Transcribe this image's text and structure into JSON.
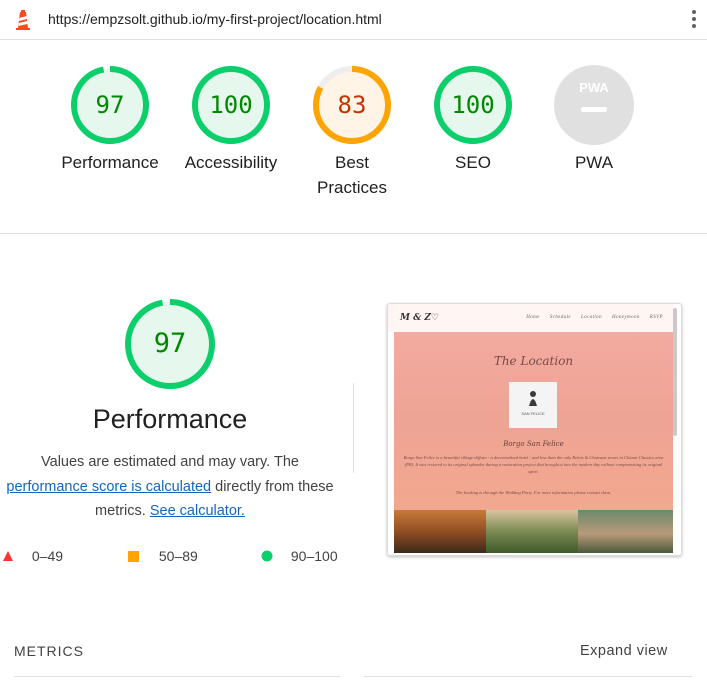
{
  "header": {
    "url": "https://empzsolt.github.io/my-first-project/location.html",
    "logo_icon": "lighthouse-icon",
    "menu_icon": "kebab-menu-icon"
  },
  "gauges": [
    {
      "label": "Performance",
      "score": "97",
      "value": 0.97,
      "color": "#0cce6b",
      "fill": "#e6f8ee",
      "text_color": "#008800"
    },
    {
      "label": "Accessibility",
      "score": "100",
      "value": 1.0,
      "color": "#0cce6b",
      "fill": "#e6f8ee",
      "text_color": "#008800"
    },
    {
      "label_line1": "Best",
      "label_line2": "Practices",
      "score": "83",
      "value": 0.83,
      "color": "#ffa400",
      "fill": "#fff4e5",
      "text_color": "#c33300"
    },
    {
      "label": "SEO",
      "score": "100",
      "value": 1.0,
      "color": "#0cce6b",
      "fill": "#e6f8ee",
      "text_color": "#008800"
    },
    {
      "label": "PWA",
      "badge": "PWA",
      "color": "#e0e0e0",
      "text_color": "#ffffff"
    }
  ],
  "performance": {
    "score": "97",
    "value": 0.97,
    "title": "Performance",
    "desc_prefix": "Values are estimated and may vary. The ",
    "desc_link": "performance score is calculated",
    "desc_middle": " directly from these metrics. ",
    "desc_link2": "See calculator."
  },
  "legend": [
    {
      "range": "0–49",
      "shape": "triangle",
      "color": "#ff3333"
    },
    {
      "range": "50–89",
      "shape": "square",
      "color": "#ffa400"
    },
    {
      "range": "90–100",
      "shape": "circle",
      "color": "#0cce6b"
    }
  ],
  "screenshot": {
    "brand": "M & Z♡",
    "nav": [
      "Home",
      "Schedule",
      "Location",
      "Honeymoon",
      "RSVP"
    ],
    "heading": "The Location",
    "logo_text": "SAN FELICE",
    "subheading": "Borgo San Felice",
    "paragraph": "Borgo San Felice is a beautiful village-diffuso - a decentralised hotel - and less than the only Relais & Chateaux resort in Chianti Classico area (PR). It was restored to its original splendor during a restoration project that brought it into the modern day without compromising its original spirit.",
    "paragraph2": "The booking is through the Wedding Party. For more information please contact them."
  },
  "metrics_label": "METRICS",
  "expand_label": "Expand view"
}
